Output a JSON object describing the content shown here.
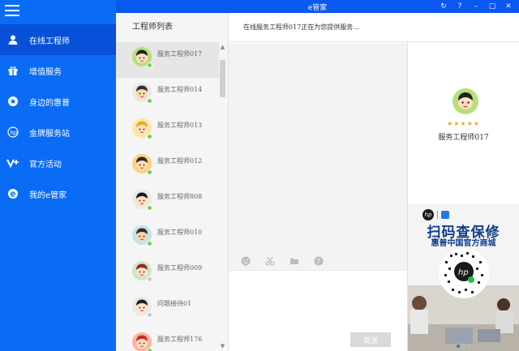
{
  "window": {
    "title": "e管家",
    "controls": [
      "refresh-icon",
      "help-icon",
      "minimize-icon",
      "maximize-icon",
      "close-icon"
    ]
  },
  "sidebar": {
    "items": [
      {
        "label": "在线工程师",
        "icon": "engineer-icon",
        "active": true
      },
      {
        "label": "增值服务",
        "icon": "gift-icon",
        "active": false
      },
      {
        "label": "身边的惠普",
        "icon": "location-icon",
        "active": false
      },
      {
        "label": "金牌服务站",
        "icon": "hp-logo-icon",
        "active": false
      },
      {
        "label": "官方活动",
        "icon": "vplus-icon",
        "active": false
      },
      {
        "label": "我的e管家",
        "icon": "e-logo-icon",
        "active": false
      }
    ]
  },
  "engineer_list": {
    "title": "工程师列表",
    "items": [
      {
        "name": "服务工程师017",
        "status": "online",
        "active": true
      },
      {
        "name": "服务工程师014",
        "status": "online",
        "active": false
      },
      {
        "name": "服务工程师013",
        "status": "online",
        "active": false
      },
      {
        "name": "服务工程师012",
        "status": "online",
        "active": false
      },
      {
        "name": "服务工程师808",
        "status": "online",
        "active": false
      },
      {
        "name": "服务工程师010",
        "status": "online",
        "active": false
      },
      {
        "name": "服务工程师009",
        "status": "offline",
        "active": false
      },
      {
        "name": "问题接待01",
        "status": "offline",
        "active": false
      },
      {
        "name": "服务工程师176",
        "status": "online",
        "active": false
      }
    ]
  },
  "chat": {
    "header": "在线服务工程师017正在为您提供服务…",
    "tools": [
      "emoji-icon",
      "scissors-icon",
      "folder-icon",
      "help-circle-icon"
    ],
    "send_label": "发送"
  },
  "profile": {
    "name": "服务工程师017",
    "rating": 5,
    "stars": "★★★★★"
  },
  "ad": {
    "headline": "扫码查保修",
    "subline": "惠普中国官方商城",
    "logo_text": "hp"
  },
  "colors": {
    "sidebar_bg": "#0a6cf5",
    "sidebar_active": "#0850d8",
    "titlebar": "#0a58ef",
    "online": "#6fcf4a",
    "offline": "#c8c8c8",
    "star": "#f5a623"
  }
}
